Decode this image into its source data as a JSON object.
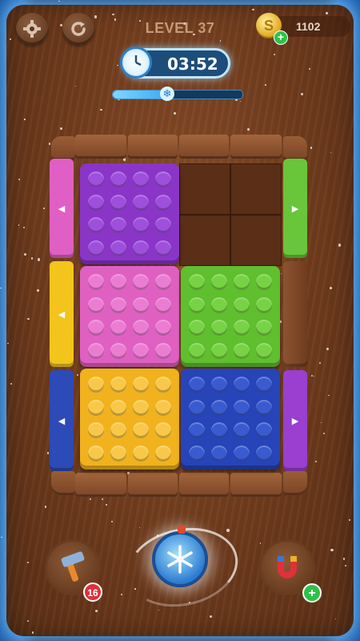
{
  "header": {
    "level_label": "LEVEL 37",
    "coins": "1102",
    "coin_symbol": "S",
    "coin_plus": "+"
  },
  "timer": {
    "time": "03:52",
    "freeze_progress": 0.45,
    "snowflake": "❄"
  },
  "board": {
    "blocks": [
      {
        "name": "purple-block",
        "color": "#8a35c8",
        "stud": "#9e4fdb"
      },
      {
        "name": "pink-block",
        "color": "#e060c2",
        "stud": "#ea7dd2"
      },
      {
        "name": "green-block",
        "color": "#5fbf2e",
        "stud": "#78d245"
      },
      {
        "name": "yellow-block",
        "color": "#f1b21e",
        "stud": "#f8c84a"
      },
      {
        "name": "blue-block",
        "color": "#2744b8",
        "stud": "#3a5bd0"
      }
    ],
    "gates": [
      {
        "name": "gate-left-pink",
        "color": "#e05fc4",
        "arrow": "◀"
      },
      {
        "name": "gate-left-yellow",
        "color": "#f2c41c",
        "arrow": "◀"
      },
      {
        "name": "gate-left-blue",
        "color": "#2c4bb8",
        "arrow": "◀"
      },
      {
        "name": "gate-right-green",
        "color": "#69c53a",
        "arrow": "▶"
      },
      {
        "name": "gate-right-purple",
        "color": "#9a3fd0",
        "arrow": "▶"
      }
    ]
  },
  "tools": {
    "hammer_count": "16",
    "magnet_plus": "+"
  },
  "colors": {
    "accent_ice": "#bfe7ff",
    "badge_red": "#e0303a",
    "badge_green": "#2ec24a"
  }
}
